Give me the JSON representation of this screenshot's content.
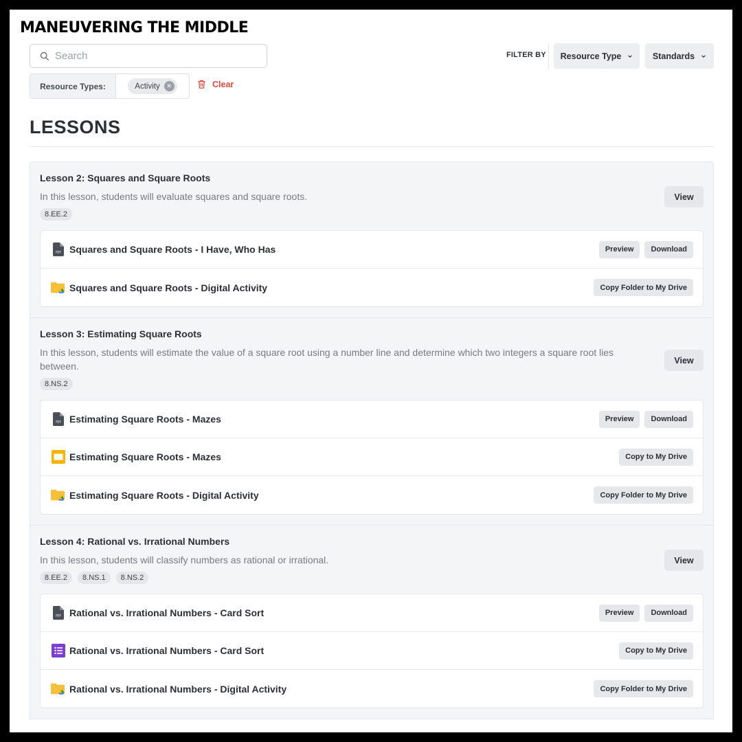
{
  "brand": "MANEUVERING THE MIDDLE",
  "search": {
    "placeholder": "Search",
    "value": ""
  },
  "filter": {
    "label": "FILTER BY",
    "dropdowns": [
      "Resource Type",
      "Standards"
    ]
  },
  "active_filters": {
    "label": "Resource Types:",
    "chips": [
      "Activity"
    ],
    "clear_label": "Clear"
  },
  "section_title": "LESSONS",
  "colors": {
    "accent_red": "#e04a3c",
    "panel_bg": "#f4f5f7",
    "button_bg": "#e5e7ea"
  },
  "lessons": [
    {
      "title": "Lesson 2: Squares and Square Roots",
      "description": "In this lesson, students will evaluate squares and square roots.",
      "standards": [
        "8.EE.2"
      ],
      "view_label": "View",
      "resources": [
        {
          "icon": "pdf-icon",
          "name": "Squares and Square Roots - I Have, Who Has",
          "actions": [
            "Preview",
            "Download"
          ]
        },
        {
          "icon": "drive-folder-icon",
          "name": "Squares and Square Roots - Digital Activity",
          "actions": [
            "Copy Folder to My Drive"
          ]
        }
      ]
    },
    {
      "title": "Lesson 3: Estimating Square Roots",
      "description": "In this lesson, students will estimate the value of a square root using a number line and determine which two integers a square root lies between.",
      "standards": [
        "8.NS.2"
      ],
      "view_label": "View",
      "resources": [
        {
          "icon": "pdf-icon",
          "name": "Estimating Square Roots - Mazes",
          "actions": [
            "Preview",
            "Download"
          ]
        },
        {
          "icon": "slides-icon",
          "name": "Estimating Square Roots - Mazes",
          "actions": [
            "Copy to My Drive"
          ]
        },
        {
          "icon": "drive-folder-icon",
          "name": "Estimating Square Roots - Digital Activity",
          "actions": [
            "Copy Folder to My Drive"
          ]
        }
      ]
    },
    {
      "title": "Lesson 4: Rational vs. Irrational Numbers",
      "description": "In this lesson, students will classify numbers as rational or irrational.",
      "standards": [
        "8.EE.2",
        "8.NS.1",
        "8.NS.2"
      ],
      "view_label": "View",
      "resources": [
        {
          "icon": "pdf-icon",
          "name": "Rational vs. Irrational Numbers - Card Sort",
          "actions": [
            "Preview",
            "Download"
          ]
        },
        {
          "icon": "forms-icon",
          "name": "Rational vs. Irrational Numbers - Card Sort",
          "actions": [
            "Copy to My Drive"
          ]
        },
        {
          "icon": "drive-folder-icon",
          "name": "Rational vs. Irrational Numbers - Digital Activity",
          "actions": [
            "Copy Folder to My Drive"
          ]
        }
      ]
    }
  ]
}
